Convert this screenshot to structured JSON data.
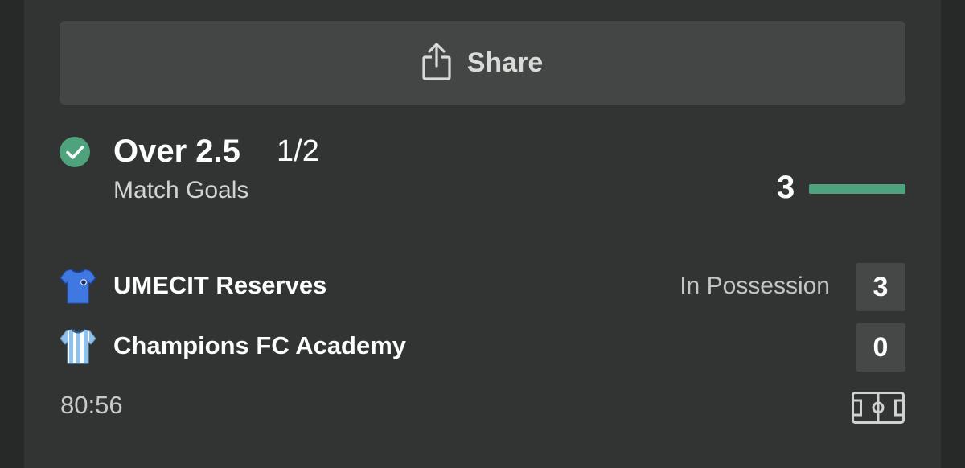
{
  "share": {
    "label": "Share",
    "icon": "share-icon"
  },
  "market": {
    "status_icon": "check-circle-icon",
    "name": "Over 2.5",
    "odds": "1/2",
    "subtitle": "Match Goals",
    "progress_value": "3",
    "progress_fraction": 1.0,
    "accent_color": "#4ea37c"
  },
  "teams": [
    {
      "name": "UMECIT Reserves",
      "status": "In Possession",
      "score": "3",
      "kit_icon": "blue-shirt-icon"
    },
    {
      "name": "Champions FC Academy",
      "status": "",
      "score": "0",
      "kit_icon": "striped-shirt-icon"
    }
  ],
  "match": {
    "time": "80:56",
    "pitch_icon": "pitch-icon"
  }
}
